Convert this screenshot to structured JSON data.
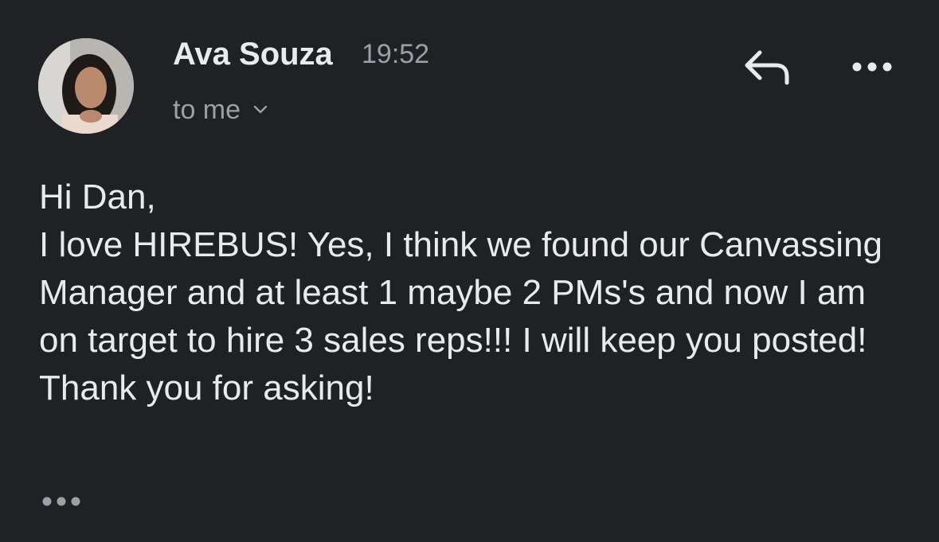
{
  "message": {
    "sender_name": "Ava Souza",
    "time": "19:52",
    "recipient_label": "to me",
    "body_lines": [
      "Hi Dan,",
      "I love HIREBUS! Yes, I think we  found our Canvassing Manager and at least 1 maybe 2 PMs's and now I am on target to hire 3 sales reps!!! I will keep you posted! Thank you for asking!"
    ]
  },
  "icons": {
    "reply": "reply-arrow-icon",
    "more": "more-horizontal-icon",
    "recipient_toggle": "chevron-down-icon",
    "trimmed_content": "ellipsis-icon"
  },
  "colors": {
    "background": "#202124",
    "primary_text": "#e8eaed",
    "secondary_text": "#9aa0a6"
  }
}
